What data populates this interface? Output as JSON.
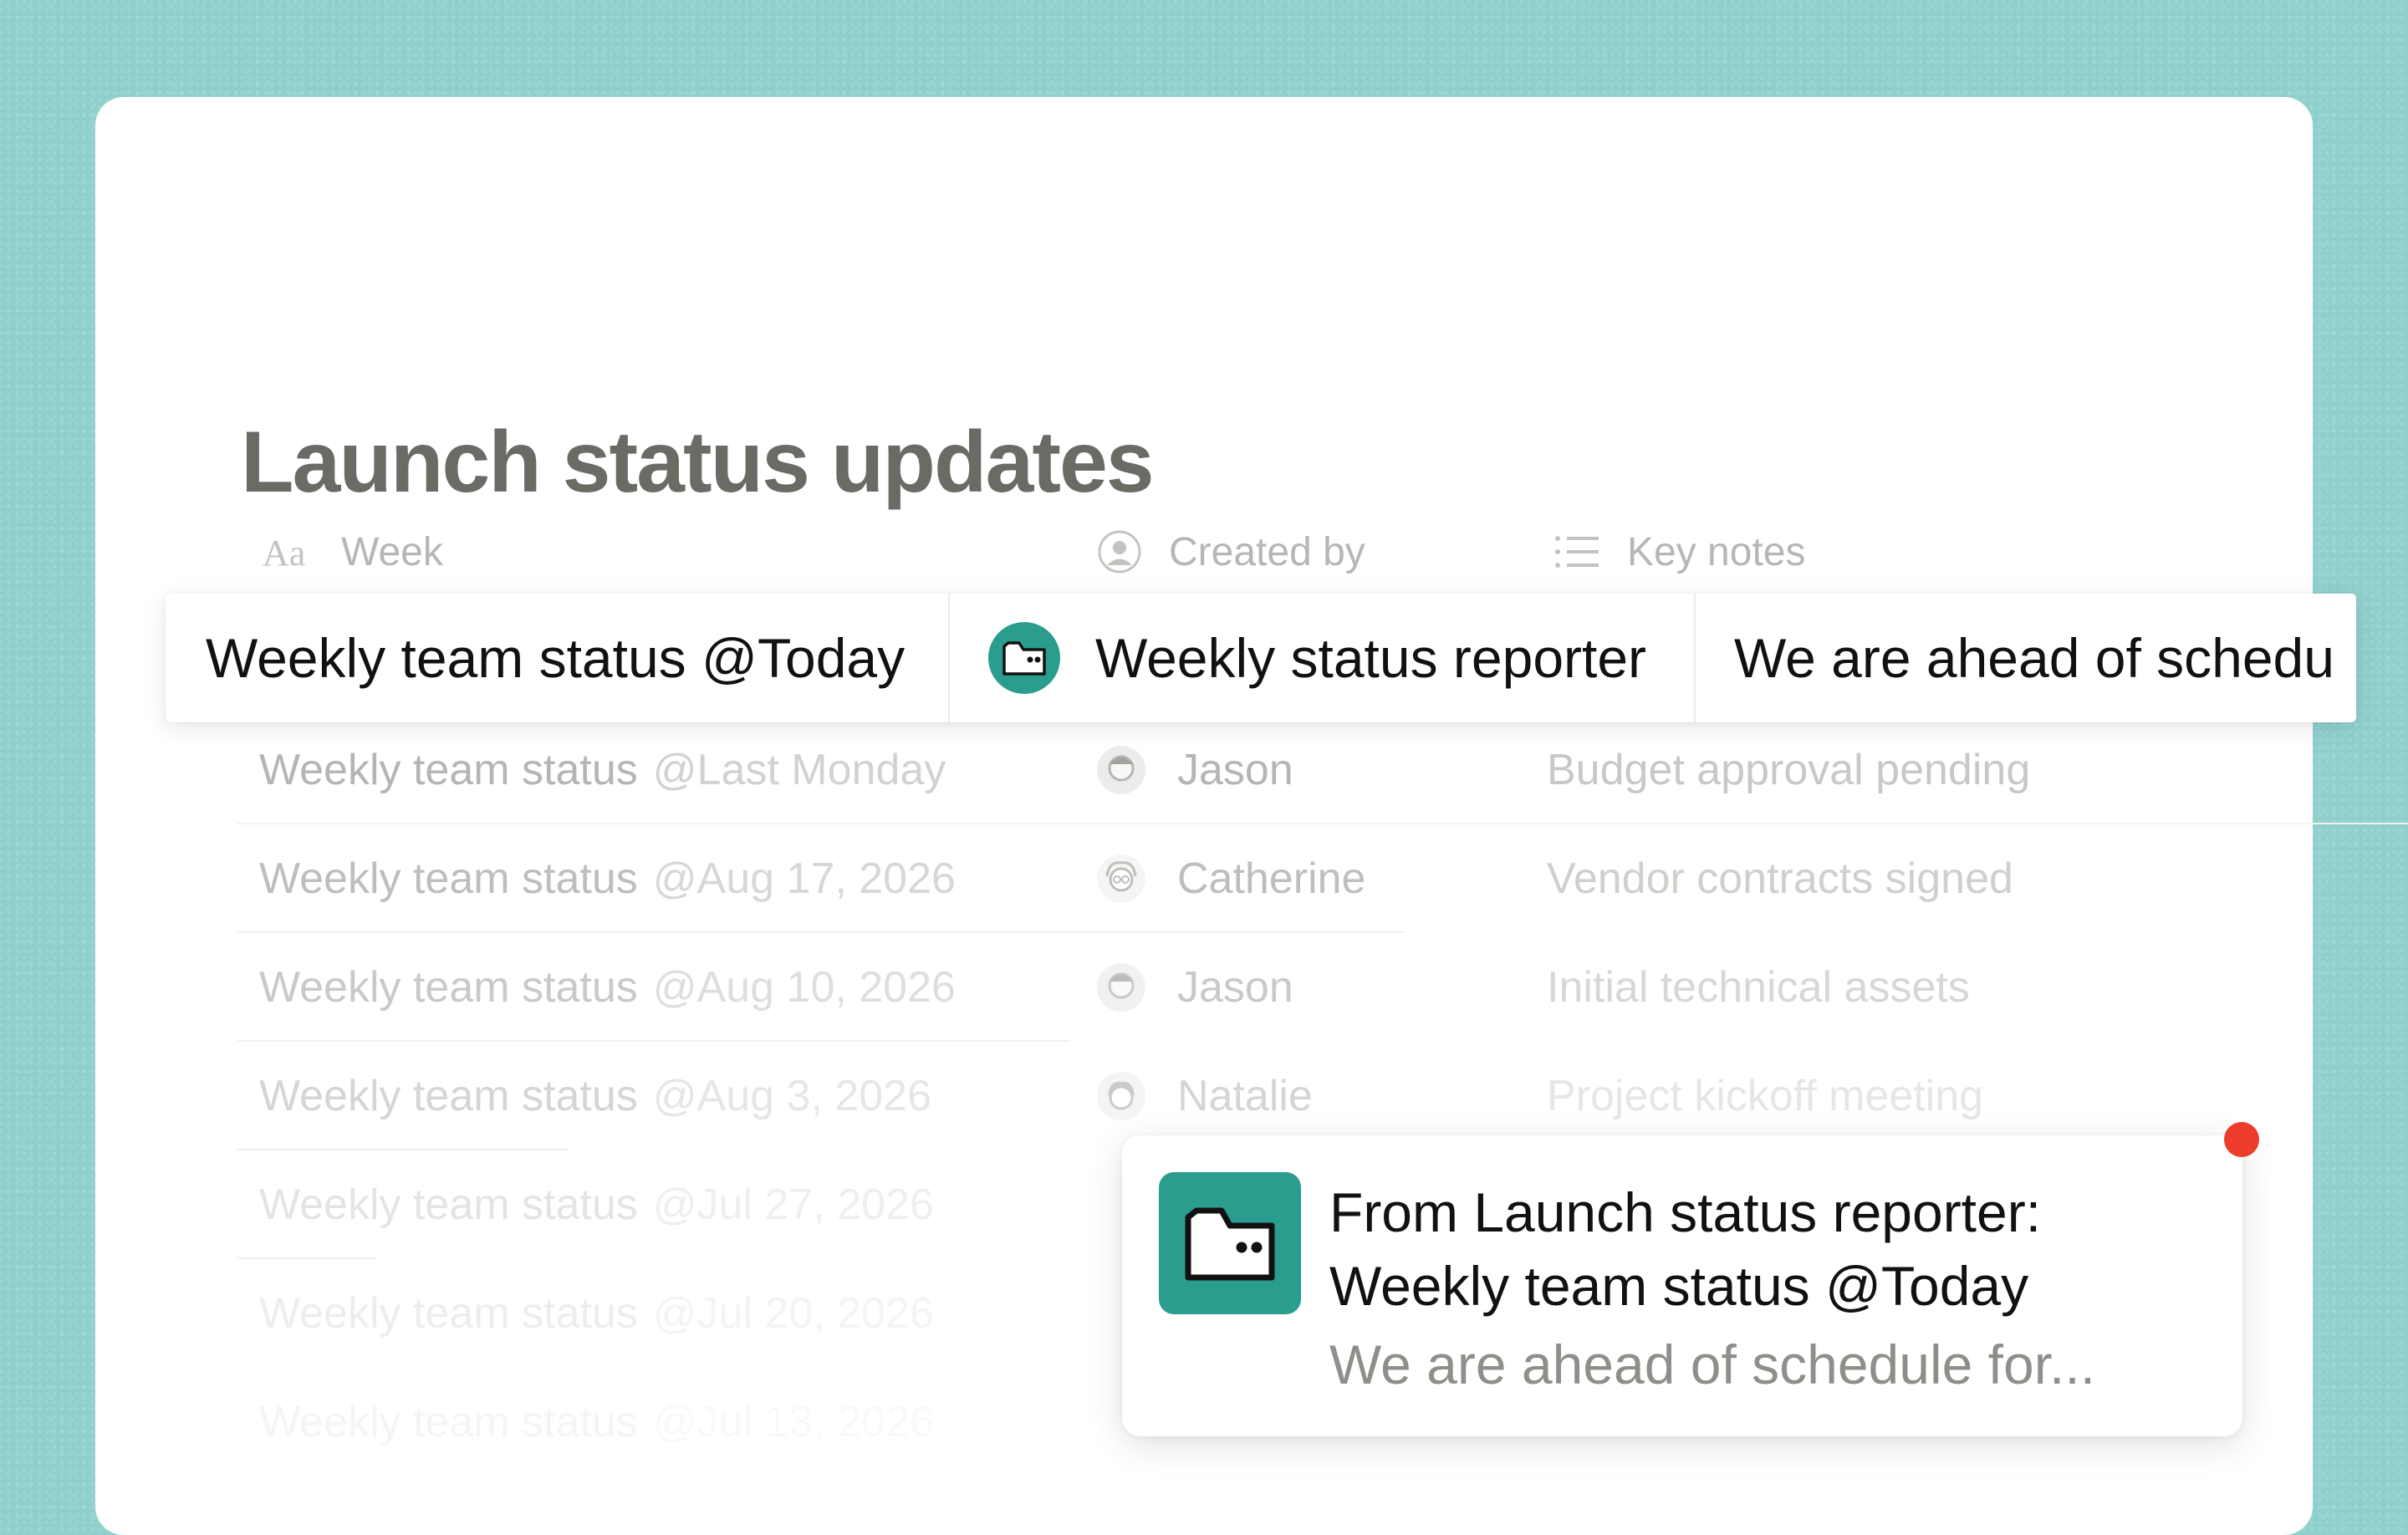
{
  "page": {
    "title": "Launch status updates"
  },
  "columns": [
    {
      "label": "Week",
      "icon": "text-type-icon"
    },
    {
      "label": "Created by",
      "icon": "person-icon"
    },
    {
      "label": "Key notes",
      "icon": "list-icon"
    }
  ],
  "highlight_row": {
    "week": "Weekly team status @Today",
    "creator": "Weekly status reporter",
    "creator_icon": "folder-bot-icon",
    "notes": "We are ahead of schedu"
  },
  "rows": [
    {
      "week": "Weekly team status",
      "date": "@Last Monday",
      "creator": "Jason",
      "notes": "Budget approval pending"
    },
    {
      "week": "Weekly team status",
      "date": "@Aug 17, 2026",
      "creator": "Catherine",
      "notes": "Vendor contracts signed"
    },
    {
      "week": "Weekly team status",
      "date": "@Aug 10, 2026",
      "creator": "Jason",
      "notes": "Initial technical assets"
    },
    {
      "week": "Weekly team status",
      "date": "@Aug 3, 2026",
      "creator": "Natalie",
      "notes": "Project kickoff meeting"
    },
    {
      "week": "Weekly team status",
      "date": "@Jul 27, 2026",
      "creator": "",
      "notes": ""
    },
    {
      "week": "Weekly team status",
      "date": "@Jul 20, 2026",
      "creator": "",
      "notes": ""
    },
    {
      "week": "Weekly team status",
      "date": "@Jul 13, 2026",
      "creator": "",
      "notes": ""
    }
  ],
  "notification": {
    "line1": "From Launch status reporter:",
    "line2": "Weekly team status @Today",
    "preview": "We are ahead of schedule for...",
    "icon": "folder-bot-icon",
    "unread_color": "#ee3c2c"
  },
  "colors": {
    "background": "#8fd0cd",
    "accent": "#2a9d8f"
  }
}
